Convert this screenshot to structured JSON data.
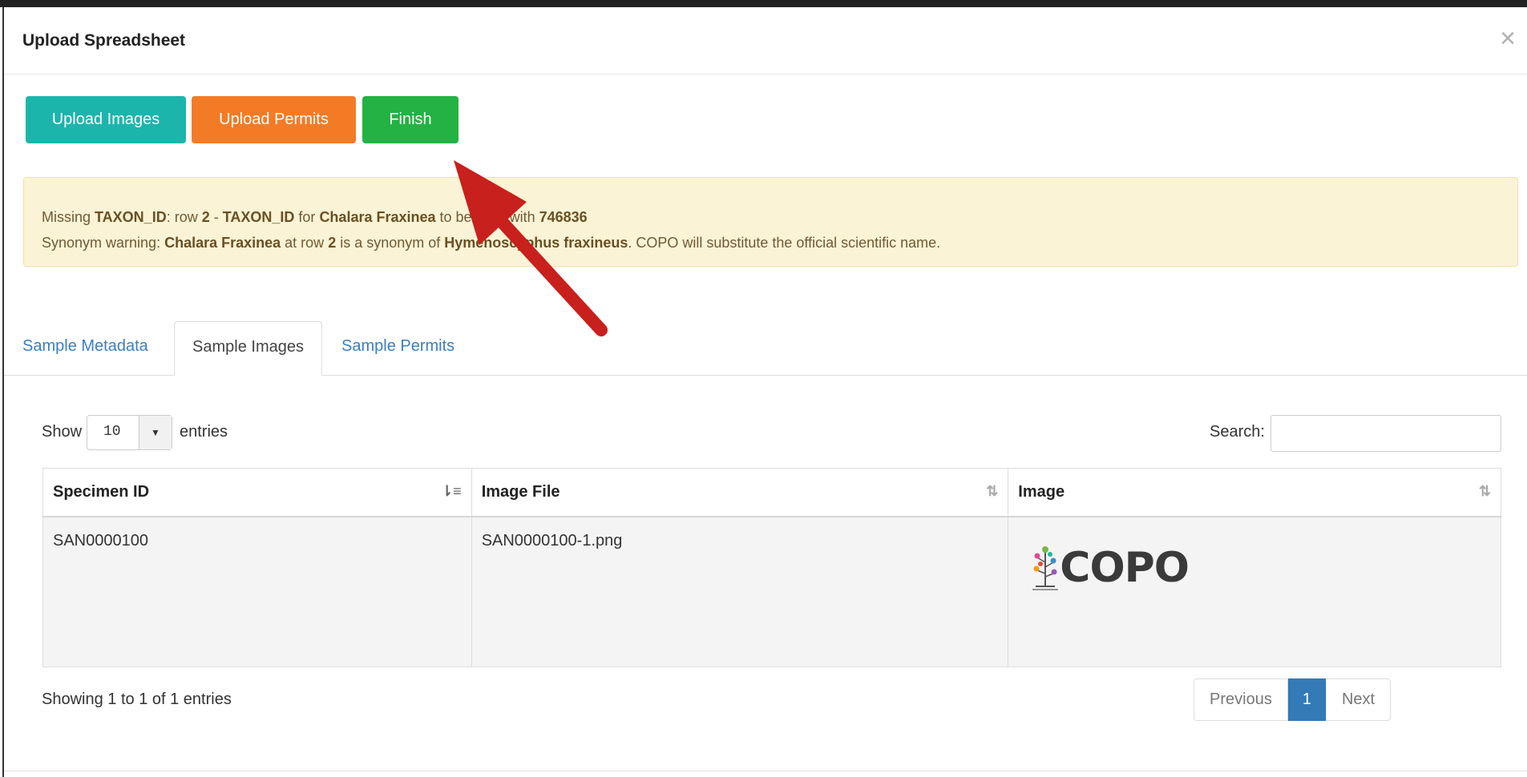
{
  "modal": {
    "title": "Upload Spreadsheet",
    "close": "×"
  },
  "buttons": {
    "upload_images": "Upload Images",
    "upload_permits": "Upload Permits",
    "finish": "Finish"
  },
  "alert": {
    "line1": {
      "a": "Missing ",
      "b": "TAXON_ID",
      "c": ": row ",
      "d": "2",
      "e": " - ",
      "f": "TAXON_ID",
      "g": " for ",
      "h": "Chalara Fraxinea",
      "i": " to be filled with ",
      "j": "746836"
    },
    "line2": {
      "a": "Synonym warning: ",
      "b": "Chalara Fraxinea",
      "c": " at row ",
      "d": "2",
      "e": " is a synonym of ",
      "f": "Hymenoscyphus fraxineus",
      "g": ". COPO will substitute the official scientific name."
    }
  },
  "tabs": [
    {
      "label": "Sample Metadata"
    },
    {
      "label": "Sample Images"
    },
    {
      "label": "Sample Permits"
    }
  ],
  "table_controls": {
    "show_label": "Show",
    "page_size": "10",
    "entries_label": "entries",
    "search_label": "Search:",
    "search_value": ""
  },
  "table": {
    "columns": [
      "Specimen ID",
      "Image File",
      "Image"
    ],
    "rows": [
      {
        "specimen_id": "SAN0000100",
        "image_file": "SAN0000100-1.png",
        "image_logo": "COPO"
      }
    ]
  },
  "footer": {
    "info": "Showing 1 to 1 of 1 entries",
    "prev": "Previous",
    "current_page": "1",
    "next": "Next"
  },
  "colors": {
    "teal": "#1cb5ac",
    "orange": "#f47b26",
    "green": "#23b243",
    "link_blue": "#3a7fc3",
    "arrow_red": "#c8201c"
  },
  "icons": [
    "close-icon",
    "sort-icon",
    "dropdown-caret-icon",
    "copo-tree-icon",
    "annotation-arrow"
  ]
}
